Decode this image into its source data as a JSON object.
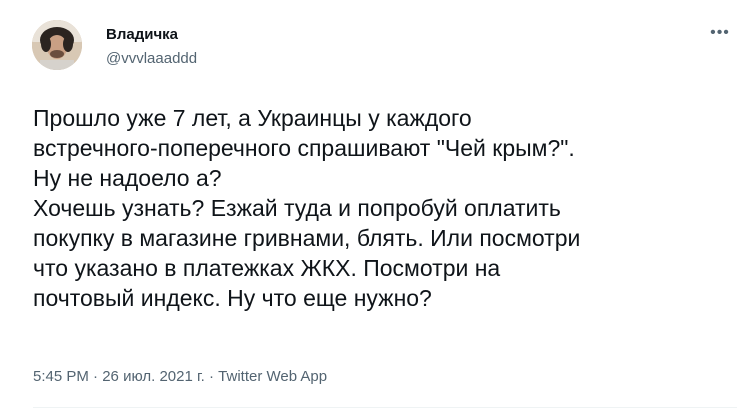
{
  "author": {
    "name": "Владичка",
    "handle": "@vvvlaaaddd"
  },
  "more_icon": "ellipsis-icon",
  "tweet": {
    "lines": [
      "Прошло уже 7 лет, а Украинцы у каждого",
      "встречного-поперечного спрашивают \"Чей крым?\".",
      "Ну не надоело а?",
      "Хочешь узнать? Езжай туда и попробуй оплатить",
      "покупку в магазине гривнами, блять. Или посмотри",
      "что указано в платежках ЖКХ. Посмотри на",
      "почтовый индекс. Ну что еще нужно?"
    ]
  },
  "meta": {
    "time": "5:45 PM",
    "separator": " · ",
    "date": "26 июл. 2021 г.",
    "source": "Twitter Web App"
  }
}
